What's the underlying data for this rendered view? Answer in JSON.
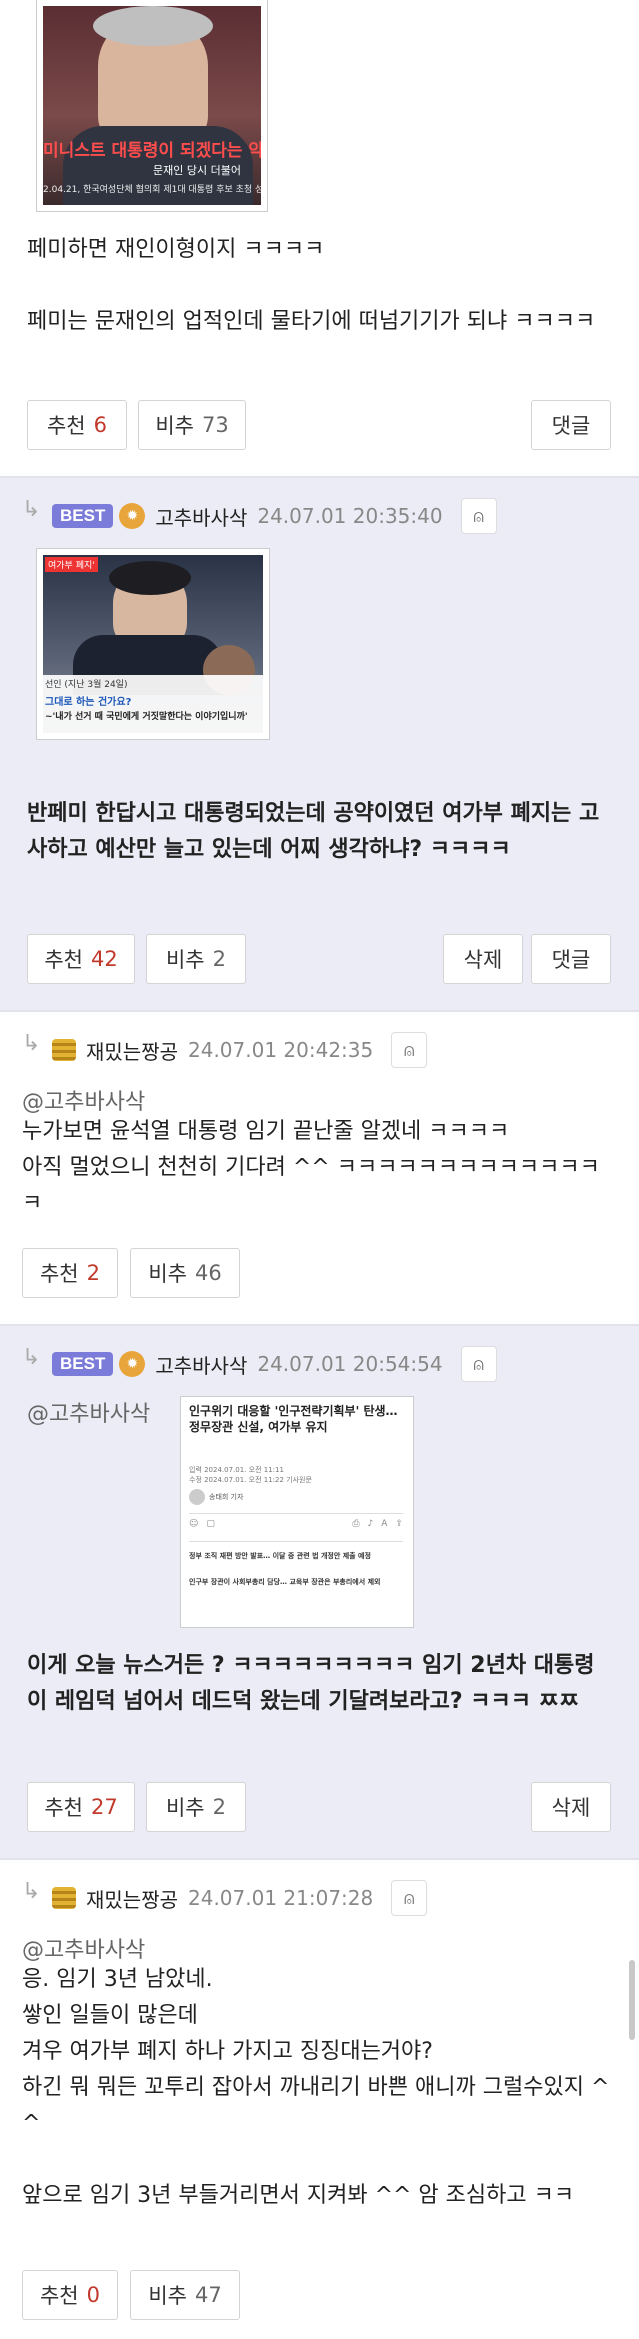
{
  "colors": {
    "best_bg": "#ececf6",
    "upvote_number": "#c0392b",
    "best_badge": "#7b7bd9"
  },
  "c1": {
    "image_caption_red": "미니스트 대통령이 되겠다는 약",
    "image_caption_name": "문재인 당시 더불어",
    "image_caption_date": "2.04.21, 한국여성단체 협의회 제1대 대통령 후보 초청 성",
    "text": "페미하면 재인이형이지 ㅋㅋㅋㅋ\n\n페미는 문재인의 업적인데 물타기에 떠넘기기가 되냐 ㅋㅋㅋㅋ",
    "up_label": "추천",
    "up_count": "6",
    "down_label": "비추",
    "down_count": "73",
    "reply_label": "댓글"
  },
  "c2": {
    "badge": "BEST",
    "nick": "고추바사삭",
    "date": "24.07.01 20:35:40",
    "image_tag": "여가부 폐지'",
    "image_caption_1": "선인 (지난 3월 24일)",
    "image_caption_2": "그대로 하는 건가요?",
    "image_caption_3": "~'내가 선거 때 국민에게 거짓말한다는 이야기입니까'",
    "text": "반페미 한답시고 대통령되었는데 공약이였던 여가부 폐지는 고사하고 예산만 늘고 있는데 어찌 생각하냐? ㅋㅋㅋㅋ",
    "up_label": "추천",
    "up_count": "42",
    "down_label": "비추",
    "down_count": "2",
    "delete_label": "삭제",
    "reply_label": "댓글"
  },
  "c3": {
    "nick": "재밌는짱공",
    "date": "24.07.01 20:42:35",
    "mention": "@고추바사삭",
    "text": "누가보면 윤석열 대통령 임기 끝난줄 알겠네 ㅋㅋㅋㅋ\n아직 멀었으니 천천히 기다려 ^^ ㅋㅋㅋㅋㅋㅋㅋㅋㅋㅋㅋㅋㅋㅋ",
    "up_label": "추천",
    "up_count": "2",
    "down_label": "비추",
    "down_count": "46"
  },
  "c4": {
    "badge": "BEST",
    "nick": "고추바사삭",
    "date": "24.07.01 20:54:54",
    "mention": "@고추바사삭",
    "news_headline": "인구위기 대응할 '인구전략기획부' 탄생… 정무장관 신설, 여가부 유지",
    "news_meta_1": "입력 2024.07.01. 오전 11:11",
    "news_meta_2": "수정 2024.07.01. 오전 11:22   기사원문",
    "news_reporter": "송태희 기자",
    "news_summary_1": "정부 조직 재편 방안 발표… 이달 중 관련 법 개정안 제출 예정",
    "news_summary_2": "인구부 장관이 사회부총리 담당… 교육부 장관은 부총리에서 제외",
    "text": "이게 오늘 뉴스거든 ? ㅋㅋㅋㅋㅋㅋㅋㅋㅋ 임기 2년차 대통령이 레임덕 넘어서 데드덕 왔는데 기달려보라고? ㅋㅋㅋ ㅉㅉ",
    "up_label": "추천",
    "up_count": "27",
    "down_label": "비추",
    "down_count": "2",
    "delete_label": "삭제"
  },
  "c5": {
    "nick": "재밌는짱공",
    "date": "24.07.01 21:07:28",
    "mention": "@고추바사삭",
    "text": "응. 임기 3년 남았네.\n쌓인 일들이 많은데\n겨우 여가부 폐지 하나 가지고 징징대는거야?\n하긴 뭐 뭐든 꼬투리 잡아서 까내리기 바쁜 애니까 그럴수있지 ^^\n\n앞으로 임기 3년 부들거리면서 지켜봐 ^^ 암 조심하고 ㅋㅋ",
    "up_label": "추천",
    "up_count": "0",
    "down_label": "비추",
    "down_count": "47"
  }
}
